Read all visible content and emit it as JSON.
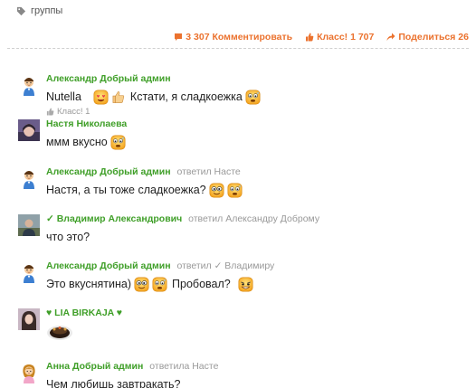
{
  "tag": {
    "label": "группы",
    "icon": "tag-icon"
  },
  "actions": [
    {
      "icon": "comment-icon",
      "label": "3 307 Комментировать"
    },
    {
      "icon": "thumb-up-icon",
      "label": "Класс! 1 707"
    },
    {
      "icon": "share-icon",
      "label": "Поделиться 26"
    }
  ],
  "colors": {
    "accent_orange": "#eb722e",
    "author_green": "#3f9f28",
    "muted": "#999999"
  },
  "comments": [
    {
      "author": "Александр Добрый админ",
      "reply": "",
      "reply_to": "",
      "text_parts": [
        "Nutella",
        "Кстати, я сладкоежка"
      ],
      "klass": "Класс! 1"
    },
    {
      "author": "Настя Николаева",
      "text_parts": [
        "ммм вкусно"
      ]
    },
    {
      "author": "Александр Добрый админ",
      "reply": "ответил Насте",
      "text_parts": [
        "Настя, а ты тоже сладкоежка?"
      ]
    },
    {
      "author": "✓ Владимир Александрович",
      "reply": "ответил Александру Доброму",
      "text_parts": [
        "что это?"
      ]
    },
    {
      "author": "Александр Добрый админ",
      "reply": "ответил",
      "reply_to": "✓ Владимиру",
      "text_parts": [
        "Это вкуснятина)",
        "Пробовал?"
      ]
    },
    {
      "author": "♥ LIA BIRKAJA ♥",
      "text_parts": []
    },
    {
      "author": "Анна Добрый админ",
      "reply": "ответила Насте",
      "text_parts": [
        "Чем любишь завтракать?"
      ]
    }
  ]
}
